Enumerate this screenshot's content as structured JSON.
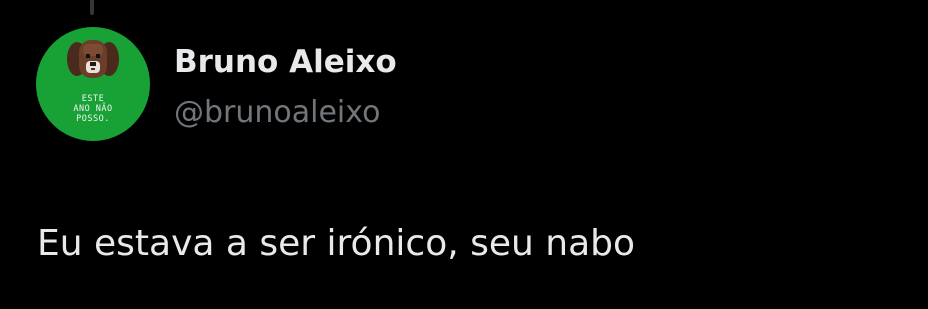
{
  "colors": {
    "background": "#000000",
    "text_primary": "#e7e9ea",
    "text_secondary": "#71767b",
    "avatar_bg": "#18a236"
  },
  "avatar": {
    "icon": "dog-avatar-icon",
    "caption_lines": [
      "ESTE",
      "ANO NÃO",
      "POSSO."
    ]
  },
  "author": {
    "display_name": "Bruno Aleixo",
    "handle": "@brunoaleixo"
  },
  "tweet": {
    "text": "Eu estava a ser irónico, seu nabo"
  }
}
